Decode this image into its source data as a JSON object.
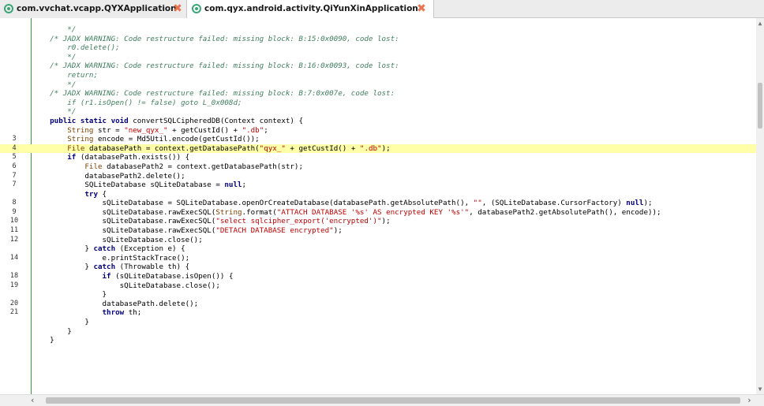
{
  "tabs": [
    {
      "label": "com.vvchat.vcapp.QYXApplication",
      "close": "✖",
      "active": false
    },
    {
      "label": "com.qyx.android.activity.QiYunXinApplication",
      "close": "✖",
      "active": true
    }
  ],
  "colors": {
    "comment": "#3f7f5f",
    "keyword": "#000080",
    "string": "#c00000",
    "highlight": "#ffffa8",
    "gutter_border": "#3c9a3c",
    "tab_icon": "#3aa675"
  },
  "editor": {
    "lines": [
      {
        "n": "",
        "hl": false,
        "segs": [
          {
            "c": "cm",
            "t": "        */"
          }
        ]
      },
      {
        "n": "",
        "hl": false,
        "segs": [
          {
            "c": "cm",
            "t": "    /* JADX WARNING: Code restructure failed: missing block: B:15:0x0090, code lost:"
          }
        ]
      },
      {
        "n": "",
        "hl": false,
        "segs": [
          {
            "c": "cm",
            "t": "        r0.delete();"
          }
        ]
      },
      {
        "n": "",
        "hl": false,
        "segs": [
          {
            "c": "cm",
            "t": "        */"
          }
        ]
      },
      {
        "n": "",
        "hl": false,
        "segs": [
          {
            "c": "cm",
            "t": "    /* JADX WARNING: Code restructure failed: missing block: B:16:0x0093, code lost:"
          }
        ]
      },
      {
        "n": "",
        "hl": false,
        "segs": [
          {
            "c": "cm",
            "t": "        return;"
          }
        ]
      },
      {
        "n": "",
        "hl": false,
        "segs": [
          {
            "c": "cm",
            "t": "        */"
          }
        ]
      },
      {
        "n": "",
        "hl": false,
        "segs": [
          {
            "c": "cm",
            "t": "    /* JADX WARNING: Code restructure failed: missing block: B:7:0x007e, code lost:"
          }
        ]
      },
      {
        "n": "",
        "hl": false,
        "segs": [
          {
            "c": "cm",
            "t": "        if (r1.isOpen() != false) goto L_0x008d;"
          }
        ]
      },
      {
        "n": "",
        "hl": false,
        "segs": [
          {
            "c": "cm",
            "t": "        */"
          }
        ]
      },
      {
        "n": "",
        "hl": false,
        "segs": [
          {
            "c": "",
            "t": "    "
          },
          {
            "c": "kw",
            "t": "public static void"
          },
          {
            "c": "",
            "t": " convertSQLCipheredDB(Context context) {"
          }
        ]
      },
      {
        "n": "",
        "hl": false,
        "segs": [
          {
            "c": "",
            "t": "        "
          },
          {
            "c": "ty",
            "t": "String"
          },
          {
            "c": "",
            "t": " str = "
          },
          {
            "c": "st",
            "t": "\"new_qyx_\""
          },
          {
            "c": "",
            "t": " + getCustId() + "
          },
          {
            "c": "st",
            "t": "\".db\""
          },
          {
            "c": "",
            "t": ";"
          }
        ]
      },
      {
        "n": "3",
        "hl": false,
        "segs": [
          {
            "c": "",
            "t": "        "
          },
          {
            "c": "ty",
            "t": "String"
          },
          {
            "c": "",
            "t": " encode = Md5Util.encode(getCustId());"
          }
        ]
      },
      {
        "n": "4",
        "hl": true,
        "segs": [
          {
            "c": "",
            "t": "        "
          },
          {
            "c": "ty",
            "t": "File"
          },
          {
            "c": "",
            "t": " databasePath = context.getDatabasePath("
          },
          {
            "c": "st",
            "t": "\"qyx_\""
          },
          {
            "c": "",
            "t": " + getCustId() + "
          },
          {
            "c": "st",
            "t": "\".db\""
          },
          {
            "c": "",
            "t": ");"
          }
        ]
      },
      {
        "n": "5",
        "hl": false,
        "segs": [
          {
            "c": "",
            "t": "        "
          },
          {
            "c": "kw",
            "t": "if"
          },
          {
            "c": "",
            "t": " (databasePath.exists()) {"
          }
        ]
      },
      {
        "n": "6",
        "hl": false,
        "segs": [
          {
            "c": "",
            "t": "            "
          },
          {
            "c": "ty",
            "t": "File"
          },
          {
            "c": "",
            "t": " databasePath2 = context.getDatabasePath(str);"
          }
        ]
      },
      {
        "n": "7",
        "hl": false,
        "segs": [
          {
            "c": "",
            "t": "            databasePath2.delete();"
          }
        ]
      },
      {
        "n": "7",
        "hl": false,
        "segs": [
          {
            "c": "",
            "t": "            SQLiteDatabase sQLiteDatabase = "
          },
          {
            "c": "kw",
            "t": "null"
          },
          {
            "c": "",
            "t": ";"
          }
        ]
      },
      {
        "n": "",
        "hl": false,
        "segs": [
          {
            "c": "",
            "t": "            "
          },
          {
            "c": "kw",
            "t": "try"
          },
          {
            "c": "",
            "t": " {"
          }
        ]
      },
      {
        "n": "8",
        "hl": false,
        "segs": [
          {
            "c": "",
            "t": "                sQLiteDatabase = SQLiteDatabase.openOrCreateDatabase(databasePath.getAbsolutePath(), "
          },
          {
            "c": "st",
            "t": "\"\""
          },
          {
            "c": "",
            "t": ", (SQLiteDatabase.CursorFactory) "
          },
          {
            "c": "kw",
            "t": "null"
          },
          {
            "c": "",
            "t": ");"
          }
        ]
      },
      {
        "n": "9",
        "hl": false,
        "segs": [
          {
            "c": "",
            "t": "                sQLiteDatabase.rawExecSQL("
          },
          {
            "c": "ty",
            "t": "String"
          },
          {
            "c": "",
            "t": ".format("
          },
          {
            "c": "st",
            "t": "\"ATTACH DATABASE '%s' AS encrypted KEY '%s'\""
          },
          {
            "c": "",
            "t": ", databasePath2.getAbsolutePath(), encode));"
          }
        ]
      },
      {
        "n": "10",
        "hl": false,
        "segs": [
          {
            "c": "",
            "t": "                sQLiteDatabase.rawExecSQL("
          },
          {
            "c": "st",
            "t": "\"select sqlcipher_export('encrypted')\""
          },
          {
            "c": "",
            "t": ");"
          }
        ]
      },
      {
        "n": "11",
        "hl": false,
        "segs": [
          {
            "c": "",
            "t": "                sQLiteDatabase.rawExecSQL("
          },
          {
            "c": "st",
            "t": "\"DETACH DATABASE encrypted\""
          },
          {
            "c": "",
            "t": ");"
          }
        ]
      },
      {
        "n": "12",
        "hl": false,
        "segs": [
          {
            "c": "",
            "t": "                sQLiteDatabase.close();"
          }
        ]
      },
      {
        "n": "",
        "hl": false,
        "segs": [
          {
            "c": "",
            "t": "            } "
          },
          {
            "c": "kw",
            "t": "catch"
          },
          {
            "c": "",
            "t": " (Exception e) {"
          }
        ]
      },
      {
        "n": "14",
        "hl": false,
        "segs": [
          {
            "c": "",
            "t": "                e.printStackTrace();"
          }
        ]
      },
      {
        "n": "",
        "hl": false,
        "segs": [
          {
            "c": "",
            "t": "            } "
          },
          {
            "c": "kw",
            "t": "catch"
          },
          {
            "c": "",
            "t": " (Throwable th) {"
          }
        ]
      },
      {
        "n": "18",
        "hl": false,
        "segs": [
          {
            "c": "",
            "t": "                "
          },
          {
            "c": "kw",
            "t": "if"
          },
          {
            "c": "",
            "t": " (sQLiteDatabase.isOpen()) {"
          }
        ]
      },
      {
        "n": "19",
        "hl": false,
        "segs": [
          {
            "c": "",
            "t": "                    sQLiteDatabase.close();"
          }
        ]
      },
      {
        "n": "",
        "hl": false,
        "segs": [
          {
            "c": "",
            "t": "                }"
          }
        ]
      },
      {
        "n": "20",
        "hl": false,
        "segs": [
          {
            "c": "",
            "t": "                databasePath.delete();"
          }
        ]
      },
      {
        "n": "21",
        "hl": false,
        "segs": [
          {
            "c": "",
            "t": "                "
          },
          {
            "c": "kw",
            "t": "throw"
          },
          {
            "c": "",
            "t": " th;"
          }
        ]
      },
      {
        "n": "",
        "hl": false,
        "segs": [
          {
            "c": "",
            "t": "            }"
          }
        ]
      },
      {
        "n": "",
        "hl": false,
        "segs": [
          {
            "c": "",
            "t": "        }"
          }
        ]
      },
      {
        "n": "",
        "hl": false,
        "segs": [
          {
            "c": "",
            "t": "    }"
          }
        ]
      }
    ]
  },
  "scrollbars": {
    "left_arrow": "‹",
    "right_arrow": "›",
    "up_arrow": "▲",
    "down_arrow": "▼"
  }
}
